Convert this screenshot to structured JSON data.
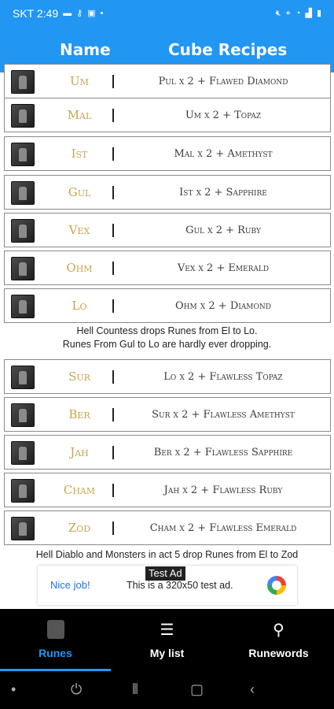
{
  "status_bar": {
    "carrier_time": "SKT 2:49"
  },
  "header": {
    "col_name": "Name",
    "col_recipes": "Cube Recipes"
  },
  "rows_a": [
    {
      "rune": "Um",
      "recipe": "Pul x 2 + Flawed Diamond"
    },
    {
      "rune": "Mal",
      "recipe": "Um x 2 + Topaz"
    },
    {
      "rune": "Ist",
      "recipe": "Mal x 2 + Amethyst"
    },
    {
      "rune": "Gul",
      "recipe": "Ist x 2 + Sapphire"
    },
    {
      "rune": "Vex",
      "recipe": "Gul x 2 + Ruby"
    },
    {
      "rune": "Ohm",
      "recipe": "Vex x 2 + Emerald"
    },
    {
      "rune": "Lo",
      "recipe": "Ohm x 2 + Diamond"
    }
  ],
  "note_1_line1": "Hell Countess drops Runes from El to Lo.",
  "note_1_line2": "Runes From Gul to Lo are hardly ever dropping.",
  "rows_b": [
    {
      "rune": "Sur",
      "recipe": "Lo x 2 + Flawless Topaz"
    },
    {
      "rune": "Ber",
      "recipe": "Sur x 2 + Flawless Amethyst"
    },
    {
      "rune": "Jah",
      "recipe": "Ber x 2 + Flawless Sapphire"
    },
    {
      "rune": "Cham",
      "recipe": "Jah x 2 + Flawless Ruby"
    },
    {
      "rune": "Zod",
      "recipe": "Cham x 2 + Flawless Emerald"
    }
  ],
  "note_2": "Hell Diablo and Monsters in act 5 drop Runes from El to Zod",
  "ad": {
    "label": "Test Ad",
    "nice": "Nice job!",
    "text": "This is a 320x50 test ad."
  },
  "tabs": [
    {
      "label": "Runes",
      "active": true
    },
    {
      "label": "My list",
      "active": false
    },
    {
      "label": "Runewords",
      "active": false
    }
  ],
  "colors": {
    "primary": "#2196F3",
    "rune_name": "#c9a44c"
  }
}
